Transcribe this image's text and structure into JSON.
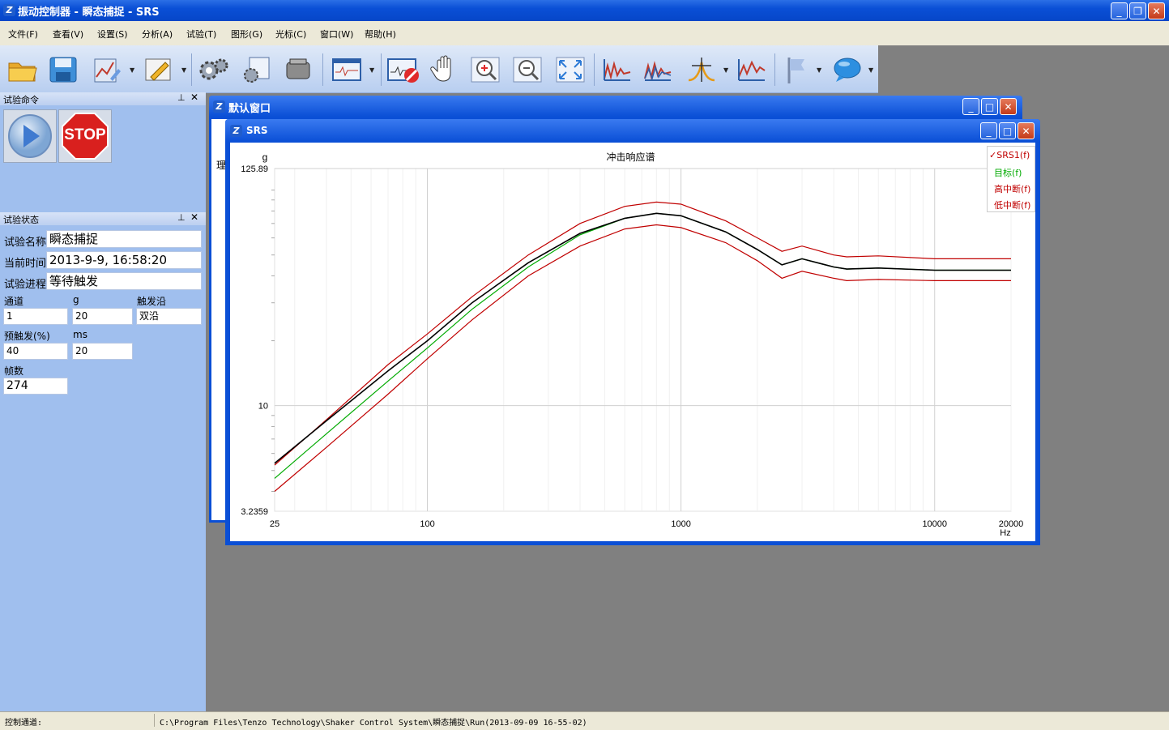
{
  "app": {
    "title": "振动控制器 - 瞬态捕捉 - SRS",
    "icon": "app-logo-icon"
  },
  "menu": [
    {
      "label": "文件(F)"
    },
    {
      "label": "查看(V)"
    },
    {
      "label": "设置(S)"
    },
    {
      "label": "分析(A)"
    },
    {
      "label": "试验(T)"
    },
    {
      "label": "图形(G)"
    },
    {
      "label": "光标(C)"
    },
    {
      "label": "窗口(W)"
    },
    {
      "label": "帮助(H)"
    }
  ],
  "toolbar": {
    "icons": [
      "open-folder-icon",
      "save-icon",
      "chart-edit-icon",
      "pencil-icon",
      "gears-icon",
      "settings-doc-icon",
      "shaker-icon",
      "waveform-window-icon",
      "stop-record-icon",
      "hand-pan-icon",
      "zoom-in-icon",
      "zoom-out-icon",
      "fit-view-icon",
      "spectrum-icon",
      "spectrum-multi-icon",
      "cursor-peak-icon",
      "spectrum-line-icon",
      "flag-icon",
      "comment-icon"
    ]
  },
  "test_command_panel": {
    "header": "试验命令",
    "play_icon": "play-icon",
    "stop_label": "STOP"
  },
  "test_status_panel": {
    "header": "试验状态",
    "name_label": "试验名称",
    "name_value": "瞬态捕捉",
    "time_label": "当前时间",
    "time_value": "2013-9-9, 16:58:20",
    "progress_label": "试验进程",
    "progress_value": "等待触发",
    "channel_label": "通道",
    "channel_value": "1",
    "g_label": "g",
    "g_value": "20",
    "edge_label": "触发沿",
    "edge_value": "双沿",
    "pretrigger_label": "预触发(%)",
    "pretrigger_value": "40",
    "ms_label": "ms",
    "ms_value": "20",
    "frames_label": "帧数",
    "frames_value": "274"
  },
  "default_window": {
    "title": "默认窗口",
    "partial_text": "理"
  },
  "srs_window": {
    "title": "SRS"
  },
  "chart_data": {
    "type": "line",
    "title": "冲击响应谱",
    "ylabel": "g",
    "xlabel": "Hz",
    "xscale": "log",
    "yscale": "log",
    "xlim": [
      25,
      20000
    ],
    "ylim": [
      3.2359,
      125.89
    ],
    "x_ticks": [
      "25",
      "100",
      "1000",
      "10000",
      "20000"
    ],
    "y_ticks": [
      "125.89",
      "10",
      "3.2359"
    ],
    "grid": true,
    "legend_position": "top-right",
    "series": [
      {
        "name": "SRS1(f)",
        "color": "#000000",
        "checked": true,
        "x": [
          25,
          40,
          70,
          100,
          150,
          250,
          400,
          600,
          800,
          1000,
          1500,
          2000,
          2500,
          3000,
          4000,
          4500,
          6000,
          10000,
          20000
        ],
        "y": [
          5.4,
          8.5,
          14.5,
          20,
          30,
          46,
          63,
          74,
          78,
          76,
          64,
          53,
          45,
          48,
          44,
          43,
          43.5,
          42.5,
          42.5
        ]
      },
      {
        "name": "目标(f)",
        "color": "#00aa00",
        "x": [
          25,
          40,
          70,
          100,
          150,
          250,
          400,
          600,
          800,
          1000,
          1500,
          2000,
          2500,
          3000,
          4000,
          4500,
          6000,
          10000,
          20000
        ],
        "y": [
          4.6,
          7.4,
          13,
          18.5,
          28,
          44,
          62,
          74,
          78,
          76,
          64,
          53,
          45,
          48,
          44,
          43,
          43.5,
          42.5,
          42.5
        ]
      },
      {
        "name": "高中断(f)",
        "color": "#c00000",
        "x": [
          25,
          40,
          70,
          100,
          150,
          250,
          400,
          600,
          800,
          1000,
          1500,
          2000,
          2500,
          3000,
          4000,
          4500,
          6000,
          10000,
          20000
        ],
        "y": [
          5.3,
          8.6,
          15.5,
          21.5,
          32,
          50,
          70,
          84,
          88,
          86,
          72,
          60,
          52,
          55,
          50,
          49,
          49.5,
          48,
          48
        ]
      },
      {
        "name": "低中断(f)",
        "color": "#c00000",
        "x": [
          25,
          40,
          70,
          100,
          150,
          250,
          400,
          600,
          800,
          1000,
          1500,
          2000,
          2500,
          3000,
          4000,
          4500,
          6000,
          10000,
          20000
        ],
        "y": [
          4.0,
          6.4,
          11.3,
          16.5,
          25,
          40,
          55,
          66,
          69,
          67,
          57,
          47,
          39,
          42,
          39,
          38,
          38.5,
          38,
          38
        ]
      }
    ]
  },
  "status_bar": {
    "channel_label": "控制通道:",
    "path": "C:\\Program Files\\Tenzo Technology\\Shaker Control System\\瞬态捕捉\\Run(2013-09-09 16-55-02)"
  }
}
